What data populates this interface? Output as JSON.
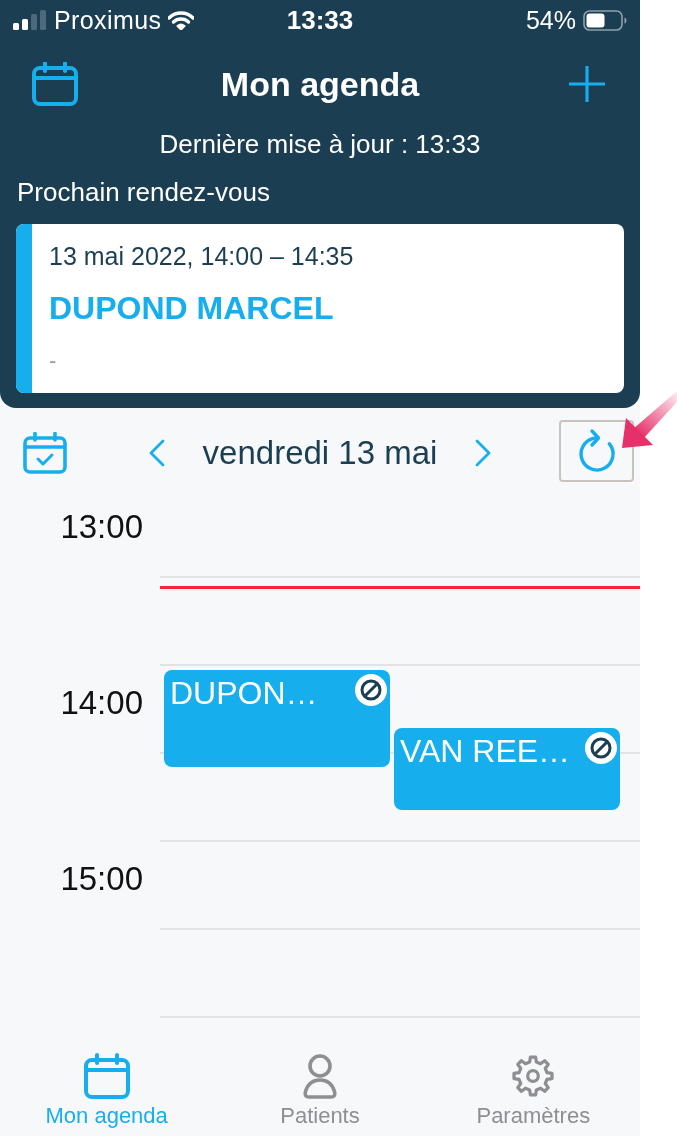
{
  "status_bar": {
    "carrier": "Proximus",
    "time": "13:33",
    "battery": "54%"
  },
  "header": {
    "title": "Mon agenda",
    "last_update": "Dernière mise à jour : 13:33",
    "next_label": "Prochain rendez-vous"
  },
  "next_appointment": {
    "datetime": "13 mai 2022, 14:00 – 14:35",
    "patient": "DUPOND MARCEL",
    "note": "-"
  },
  "date_nav": {
    "date": "vendredi 13 mai"
  },
  "timeline": {
    "hours": [
      "13:00",
      "14:00",
      "15:00"
    ],
    "events": [
      {
        "title": "DUPON…"
      },
      {
        "title": "VAN REE…"
      }
    ]
  },
  "tab_bar": {
    "tabs": [
      {
        "label": "Mon agenda",
        "selected": true
      },
      {
        "label": "Patients",
        "selected": false
      },
      {
        "label": "Paramètres",
        "selected": false
      }
    ]
  }
}
